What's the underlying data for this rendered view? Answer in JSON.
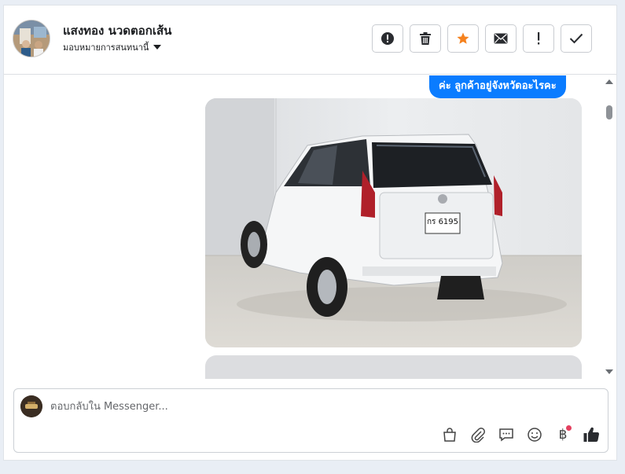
{
  "header": {
    "contact_name": "แสงทอง นวดตอกเส้น",
    "assign_label": "มอบหมายการสนทนานี้"
  },
  "actions": [
    {
      "name": "report-button",
      "icon": "exclamation-circle-icon"
    },
    {
      "name": "delete-button",
      "icon": "trash-icon"
    },
    {
      "name": "star-button",
      "icon": "star-icon",
      "color": "#f5821f"
    },
    {
      "name": "mark-unread-button",
      "icon": "envelope-icon"
    },
    {
      "name": "follow-up-button",
      "icon": "exclamation-icon"
    },
    {
      "name": "done-button",
      "icon": "check-icon"
    }
  ],
  "messages": {
    "outgoing_text": "ค่ะ ลูกค้าอยู่จังหวัดอะไรคะ",
    "plate_text": "กร 6195",
    "bubble_color": "#0a7cff"
  },
  "composer": {
    "placeholder": "ตอบกลับใน Messenger..."
  },
  "tools": [
    {
      "name": "shop-bag-icon"
    },
    {
      "name": "attach-icon"
    },
    {
      "name": "saved-reply-icon"
    },
    {
      "name": "emoji-icon"
    },
    {
      "name": "payment-icon",
      "glyph": "฿"
    },
    {
      "name": "like-icon"
    }
  ]
}
